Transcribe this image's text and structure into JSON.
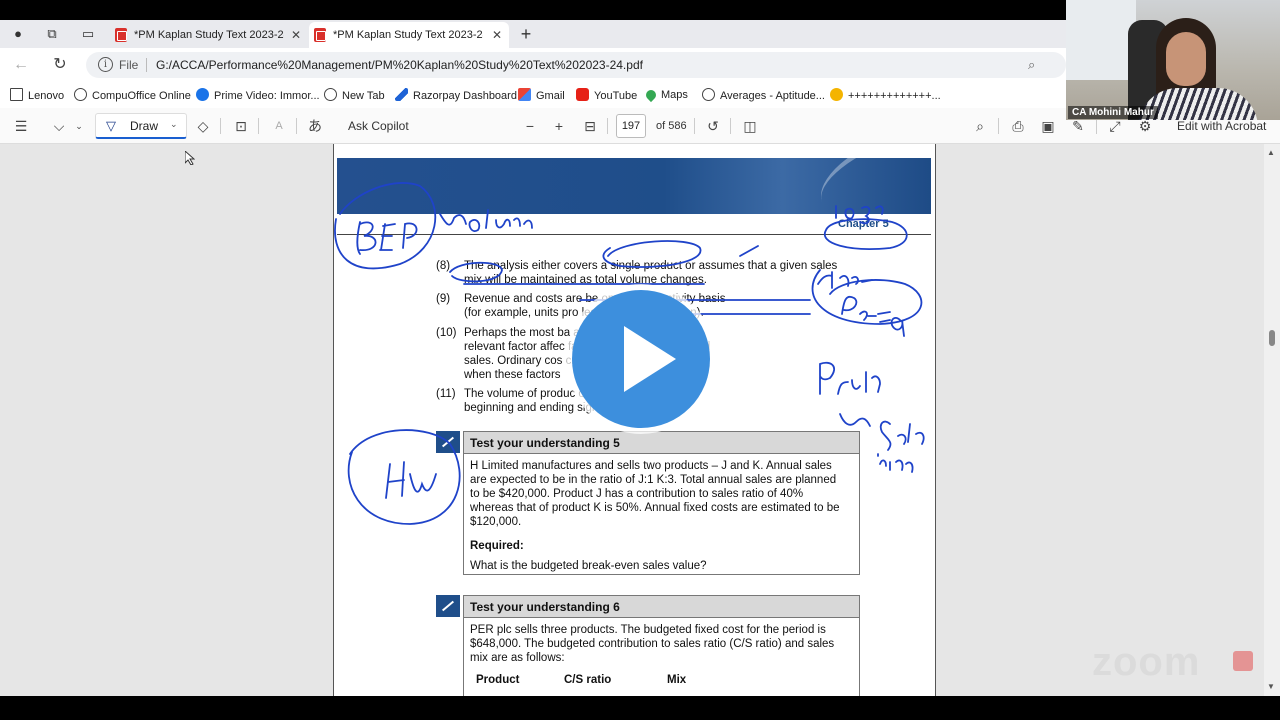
{
  "tabs": [
    {
      "label": "*PM Kaplan Study Text 2023-24.pdf",
      "active": false
    },
    {
      "label": "*PM Kaplan Study Text 2023-24.pdf",
      "active": true
    }
  ],
  "address": {
    "scheme_label": "File",
    "url": "G:/ACCA/Performance%20Management/PM%20Kaplan%20Study%20Text%202023-24.pdf"
  },
  "bookmarks": [
    {
      "label": "Lenovo",
      "icon": "folder-icon"
    },
    {
      "label": "CompuOffice Online",
      "icon": "globe-icon"
    },
    {
      "label": "Prime Video: Immor...",
      "icon": "prime-video-icon"
    },
    {
      "label": "New Tab",
      "icon": "globe-icon"
    },
    {
      "label": "Razorpay Dashboard",
      "icon": "razorpay-icon"
    },
    {
      "label": "Gmail",
      "icon": "gmail-icon"
    },
    {
      "label": "YouTube",
      "icon": "youtube-icon"
    },
    {
      "label": "Maps",
      "icon": "maps-icon"
    },
    {
      "label": "Averages - Aptitude...",
      "icon": "globe-icon"
    },
    {
      "label": "+++++++++++++...",
      "icon": "lemon-icon"
    }
  ],
  "pdf_toolbar": {
    "draw_label": "Draw",
    "ask_copilot_label": "Ask Copilot",
    "page_current": "197",
    "page_total": "of 586",
    "edit_acrobat_label": "Edit with Acrobat"
  },
  "document": {
    "chapter": "Chapter 5",
    "items": [
      {
        "num": "(8)",
        "lines": [
          "The analysis either covers a single product or assumes that a given sales",
          "mix will be maintained as total volume changes."
        ]
      },
      {
        "num": "(9)",
        "lines": [
          "Revenue and costs are be                  on a single activity basis",
          "(for example, units pro                     les value of production)."
        ]
      },
      {
        "num": "(10)",
        "lines": [
          "Perhaps the most ba                              at volume is the only",
          "relevant factor affec                           factors also affect costs and",
          "sales. Ordinary cos                          crude oversimplification",
          "when these factors"
        ]
      },
      {
        "num": "(11)",
        "lines": [
          "The volume of produc                          of sales, or changes in",
          "beginning and ending                        significant in amount."
        ]
      }
    ],
    "tyu5": {
      "title": "Test your understanding 5",
      "body": [
        "H Limited manufactures and sells two products – J and K. Annual sales",
        "are expected to be in the ratio of J:1 K:3. Total annual sales are planned",
        "to be $420,000. Product J has a contribution to sales ratio of 40%",
        "whereas that of product K is 50%. Annual fixed costs are estimated to be",
        "$120,000."
      ],
      "required_label": "Required:",
      "question": "What is the budgeted break-even sales value?"
    },
    "tyu6": {
      "title": "Test your understanding 6",
      "body": [
        "PER plc sells three products. The budgeted fixed cost for the period is",
        "$648,000. The budgeted contribution to sales ratio (C/S ratio) and sales",
        "mix are as follows:"
      ],
      "columns": [
        "Product",
        "C/S ratio",
        "Mix"
      ]
    }
  },
  "video": {
    "participant_name": "CA Mohini Mahur",
    "watermark": "zoom"
  },
  "colors": {
    "accent": "#1a5fd0",
    "banner": "#1f4e8a",
    "ink": "#1f43c9",
    "play": "#3d8fdd"
  }
}
